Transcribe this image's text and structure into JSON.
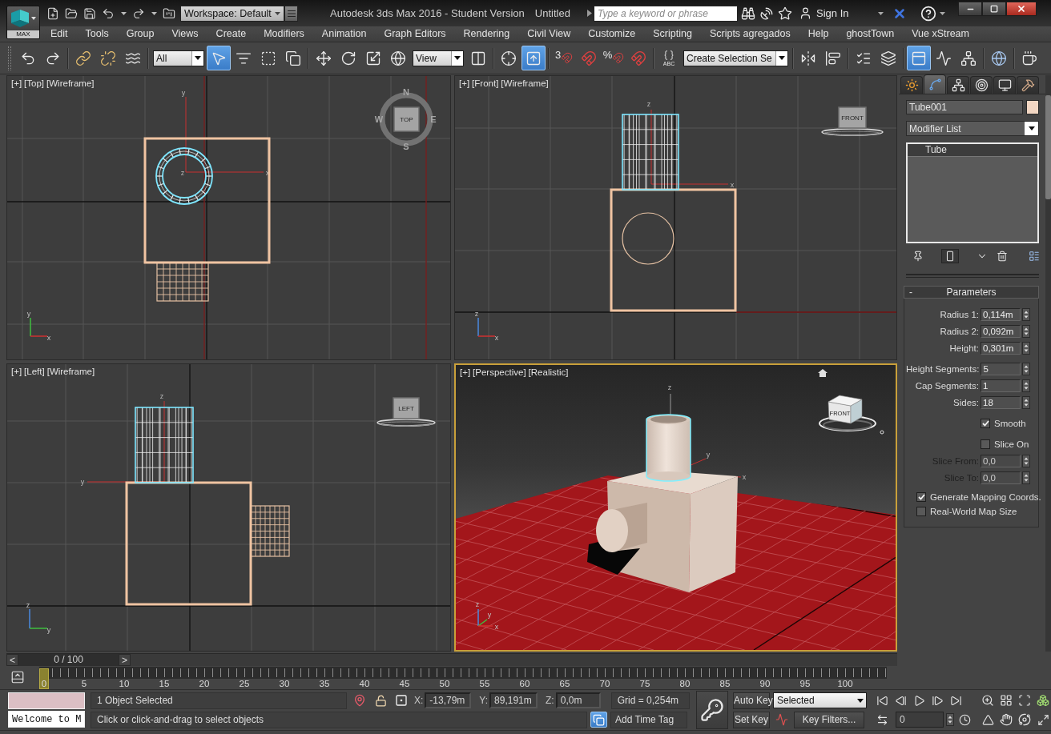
{
  "title_bar": {
    "app_button": "MAX",
    "workspace": "Workspace: Default",
    "title": "Autodesk 3ds Max 2016 - Student Version",
    "document": "Untitled",
    "search": {
      "placeholder": "Type a keyword or phrase"
    },
    "sign_in": "Sign In"
  },
  "menu": [
    "Edit",
    "Tools",
    "Group",
    "Views",
    "Create",
    "Modifiers",
    "Animation",
    "Graph Editors",
    "Rendering",
    "Civil View",
    "Customize",
    "Scripting",
    "Scripts agregados",
    "Help",
    "ghostTown",
    "Vue xStream"
  ],
  "toolbar": [
    [
      {
        "kind": "undo",
        "on": false
      },
      {
        "kind": "redo",
        "on": false
      }
    ],
    [
      {
        "kind": "link",
        "on": false
      },
      {
        "kind": "unlink",
        "on": false
      },
      {
        "kind": "bind",
        "on": false
      }
    ],
    [
      {
        "kind": "dropdown",
        "value": "All"
      },
      {
        "kind": "select",
        "on": true
      },
      {
        "kind": "select_by_name",
        "on": false
      },
      {
        "kind": "region",
        "on": false
      },
      {
        "kind": "crossing",
        "on": false
      }
    ],
    [
      {
        "kind": "move",
        "on": false
      },
      {
        "kind": "rotate",
        "on": false
      },
      {
        "kind": "scale",
        "on": false
      },
      {
        "kind": "place",
        "on": false
      },
      {
        "kind": "dropdown",
        "value": "View"
      },
      {
        "kind": "pivot",
        "on": false
      }
    ],
    [
      {
        "kind": "manipulate",
        "on": false
      },
      {
        "kind": "shortcut",
        "on": true
      }
    ],
    [
      {
        "kind": "snap",
        "label": "3",
        "on": false
      },
      {
        "kind": "angle_snap",
        "on": false
      },
      {
        "kind": "percent_snap",
        "label": "%",
        "on": false
      },
      {
        "kind": "spinner_snap",
        "on": false
      }
    ],
    [
      {
        "kind": "named_sets",
        "label": "ABC",
        "on": false
      },
      {
        "kind": "dropdown",
        "value": "Create Selection Se"
      }
    ],
    [
      {
        "kind": "mirror",
        "on": false
      },
      {
        "kind": "align",
        "on": false
      }
    ],
    [
      {
        "kind": "scene_explorer",
        "on": false
      },
      {
        "kind": "layers",
        "on": false
      }
    ],
    [
      {
        "kind": "ribbon",
        "on": true
      },
      {
        "kind": "curve_editor",
        "on": false
      },
      {
        "kind": "schematic",
        "on": false
      }
    ],
    [
      {
        "kind": "material",
        "on": false
      }
    ],
    [
      {
        "kind": "render_setup",
        "on": false
      }
    ]
  ],
  "viewports": [
    {
      "kind": "top",
      "active": false,
      "labels": [
        "[+]",
        "[Top]",
        "[Wireframe]"
      ],
      "view_cube": "TOP",
      "compass": [
        "N",
        "W",
        "E",
        "S"
      ],
      "gizmo_axes": [
        "y",
        "z",
        "x"
      ],
      "tripod_axes": [
        "y",
        "x"
      ]
    },
    {
      "kind": "front",
      "active": false,
      "labels": [
        "[+]",
        "[Front]",
        "[Wireframe]"
      ],
      "view_cube": "FRONT",
      "gizmo_axes": [
        "z",
        "x"
      ],
      "tripod_axes": [
        "z",
        "x"
      ]
    },
    {
      "kind": "left",
      "active": false,
      "labels": [
        "[+]",
        "[Left]",
        "[Wireframe]"
      ],
      "view_cube": "LEFT",
      "gizmo_axes": [
        "z",
        "y"
      ],
      "tripod_axes": [
        "z",
        "y"
      ]
    },
    {
      "kind": "perspective",
      "active": true,
      "labels": [
        "[+]",
        "[Perspective]",
        "[Realistic]"
      ],
      "view_cube": "FRONT",
      "gizmo_axes": [
        "z",
        "y",
        "x"
      ],
      "tripod_axes": [
        "z",
        "y",
        "x"
      ]
    }
  ],
  "command_panel": {
    "tabs": [
      {
        "kind": "create",
        "selected": false
      },
      {
        "kind": "modify",
        "selected": true
      },
      {
        "kind": "hierarchy",
        "selected": false
      },
      {
        "kind": "motion",
        "selected": false
      },
      {
        "kind": "display",
        "selected": false
      },
      {
        "kind": "utilities",
        "selected": false
      }
    ],
    "object": {
      "name": "Tube001",
      "color": "#f3d7c3"
    },
    "modifier_list": "Modifier List",
    "stack": [
      {
        "label": "Tube",
        "selected": true
      }
    ],
    "stack_buttons": [
      [
        {
          "kind": "pin",
          "on": false
        }
      ],
      [
        {
          "kind": "end_result",
          "on": true
        }
      ],
      [
        {
          "kind": "unique",
          "on": false
        },
        {
          "kind": "remove",
          "on": false
        }
      ],
      [
        {
          "kind": "configure",
          "on": false
        }
      ]
    ],
    "rollout": {
      "collapse": "-",
      "title": "Parameters",
      "groups": [
        [
          {
            "kind": "spinner",
            "label": "Radius 1:",
            "value": "0,114m",
            "disabled": false
          },
          {
            "kind": "spinner",
            "label": "Radius 2:",
            "value": "0,092m",
            "disabled": false
          },
          {
            "kind": "spinner",
            "label": "Height:",
            "value": "0,301m",
            "disabled": false
          }
        ],
        [
          {
            "kind": "spinner",
            "label": "Height Segments:",
            "value": "5",
            "disabled": false
          },
          {
            "kind": "spinner",
            "label": "Cap Segments:",
            "value": "1",
            "disabled": false
          },
          {
            "kind": "spinner",
            "label": "Sides:",
            "value": "18",
            "disabled": false
          }
        ],
        [
          {
            "kind": "checkbox",
            "label": "Smooth",
            "checked": true,
            "disabled": false
          }
        ],
        [
          {
            "kind": "checkbox",
            "label": "Slice On",
            "checked": false,
            "disabled": false
          },
          {
            "kind": "spinner",
            "label": "Slice From:",
            "value": "0,0",
            "disabled": true
          },
          {
            "kind": "spinner",
            "label": "Slice To:",
            "value": "0,0",
            "disabled": true
          }
        ],
        [
          {
            "kind": "option",
            "label": "Generate Mapping Coords.",
            "checked": true,
            "disabled": false
          },
          {
            "kind": "option",
            "label": "Real-World Map Size",
            "checked": false,
            "disabled": false
          }
        ]
      ]
    }
  },
  "time_slider": {
    "prev": "<",
    "position": "0 / 100",
    "next": ">",
    "level": 0
  },
  "track_bar": {
    "ticks": [
      "0",
      "5",
      "10",
      "15",
      "20",
      "25",
      "30",
      "35",
      "40",
      "45",
      "50",
      "55",
      "60",
      "65",
      "70",
      "75",
      "80",
      "85",
      "90",
      "95",
      "100"
    ]
  },
  "status_bar": {
    "listener": "Welcome to M",
    "selection": "1 Object Selected",
    "prompt": "Click or click-and-drag to select objects",
    "coordinates": [
      {
        "axis": "X:",
        "value": "-13,79m"
      },
      {
        "axis": "Y:",
        "value": "89,191m"
      },
      {
        "axis": "Z:",
        "value": "0,0m"
      }
    ],
    "grid": "Grid = 0,254m",
    "time_tag": "Add Time Tag",
    "auto_key": {
      "label": "Auto Key",
      "on": false
    },
    "set_key": "Set Key",
    "key_mode": "Selected",
    "key_filters": "Key Filters...",
    "frame": "0"
  }
}
